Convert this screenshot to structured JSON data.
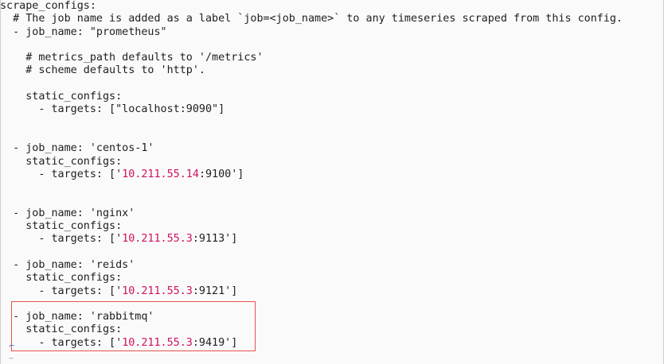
{
  "lines": [
    {
      "pre": "scrape_configs:"
    },
    {
      "pre": "  # The job name is added as a label `job=<job_name>` to any timeseries scraped from this config."
    },
    {
      "pre": "  - job_name: \"prometheus\""
    },
    {
      "pre": ""
    },
    {
      "pre": "    # metrics_path defaults to '/metrics'"
    },
    {
      "pre": "    # scheme defaults to 'http'."
    },
    {
      "pre": ""
    },
    {
      "pre": "    static_configs:"
    },
    {
      "pre": "      - targets: [\"localhost:9090\"]"
    },
    {
      "pre": ""
    },
    {
      "pre": ""
    },
    {
      "pre": "  - job_name: 'centos-1'"
    },
    {
      "pre": "    static_configs:"
    },
    {
      "pre": "      - targets: ['",
      "ip": "10.211.55.14",
      "post": ":9100']"
    },
    {
      "pre": ""
    },
    {
      "pre": ""
    },
    {
      "pre": "  - job_name: 'nginx'"
    },
    {
      "pre": "    static_configs:"
    },
    {
      "pre": "      - targets: ['",
      "ip": "10.211.55.3",
      "post": ":9113']"
    },
    {
      "pre": ""
    },
    {
      "pre": "  - job_name: 'reids'"
    },
    {
      "pre": "    static_configs:"
    },
    {
      "pre": "      - targets: ['",
      "ip": "10.211.55.3",
      "post": ":9121']"
    },
    {
      "pre": ""
    },
    {
      "pre": "  - job_name: 'rabbitmq'"
    },
    {
      "pre": "    static_configs:"
    },
    {
      "pre": "      - targets: ['",
      "ip": "10.211.55.3",
      "post": ":9419']"
    }
  ],
  "colors": {
    "text": "#1e1e1e",
    "ip": "#d0115f",
    "highlight_border": "#e5534b",
    "background": "#fafafa"
  },
  "icons": {
    "cursor": "cursor-marker-icon"
  }
}
